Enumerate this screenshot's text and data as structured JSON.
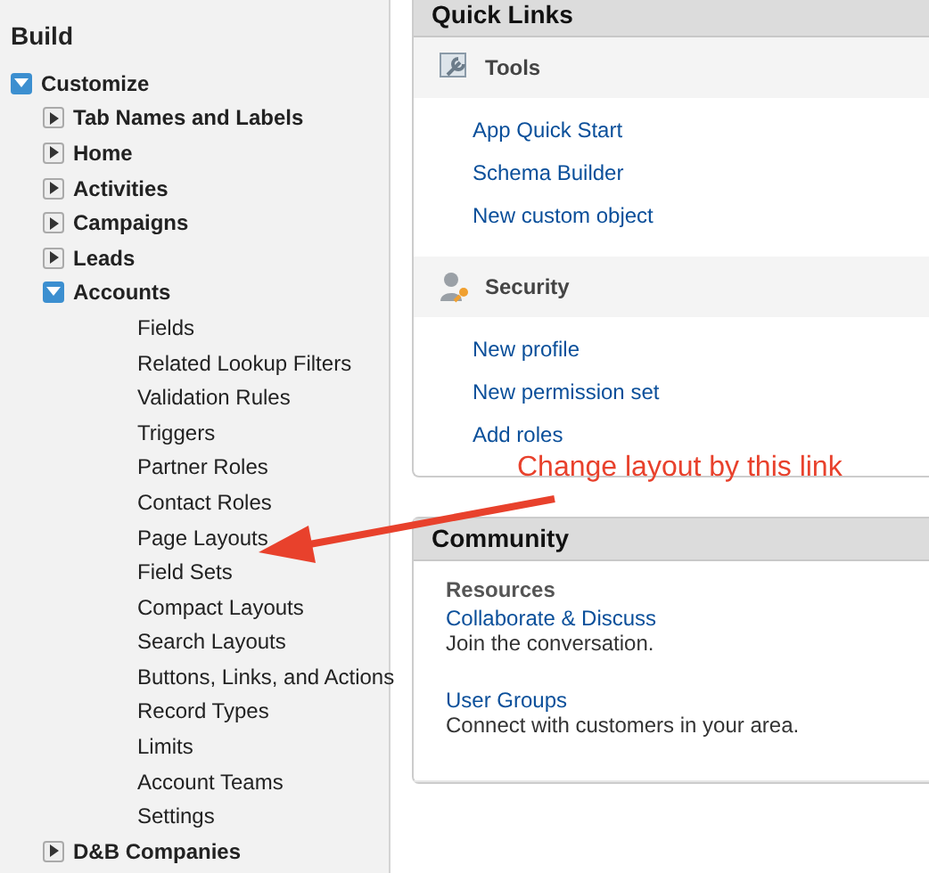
{
  "sidebar": {
    "title": "Build",
    "tree": [
      {
        "label": "Customize",
        "kind": "node",
        "expanded": true,
        "children": [
          {
            "label": "Tab Names and Labels",
            "kind": "node",
            "expanded": false
          },
          {
            "label": "Home",
            "kind": "node",
            "expanded": false
          },
          {
            "label": "Activities",
            "kind": "node",
            "expanded": false
          },
          {
            "label": "Campaigns",
            "kind": "node",
            "expanded": false
          },
          {
            "label": "Leads",
            "kind": "node",
            "expanded": false
          },
          {
            "label": "Accounts",
            "kind": "node",
            "expanded": true,
            "children": [
              {
                "label": "Fields",
                "kind": "leaf"
              },
              {
                "label": "Related Lookup Filters",
                "kind": "leaf"
              },
              {
                "label": "Validation Rules",
                "kind": "leaf"
              },
              {
                "label": "Triggers",
                "kind": "leaf"
              },
              {
                "label": "Partner Roles",
                "kind": "leaf"
              },
              {
                "label": "Contact Roles",
                "kind": "leaf"
              },
              {
                "label": "Page Layouts",
                "kind": "leaf"
              },
              {
                "label": "Field Sets",
                "kind": "leaf"
              },
              {
                "label": "Compact Layouts",
                "kind": "leaf"
              },
              {
                "label": "Search Layouts",
                "kind": "leaf"
              },
              {
                "label": "Buttons, Links, and Actions",
                "kind": "leaf"
              },
              {
                "label": "Record Types",
                "kind": "leaf"
              },
              {
                "label": "Limits",
                "kind": "leaf"
              },
              {
                "label": "Account Teams",
                "kind": "leaf"
              },
              {
                "label": "Settings",
                "kind": "leaf"
              }
            ]
          },
          {
            "label": "D&B Companies",
            "kind": "node",
            "expanded": false
          }
        ]
      }
    ]
  },
  "quick_links": {
    "title": "Quick Links",
    "sections": [
      {
        "title": "Tools",
        "kind": "tools",
        "links": [
          "App Quick Start",
          "Schema Builder",
          "New custom object"
        ]
      },
      {
        "title": "Security",
        "kind": "security",
        "links": [
          "New profile",
          "New permission set",
          "Add roles"
        ]
      }
    ]
  },
  "community": {
    "title": "Community",
    "heading": "Resources",
    "items": [
      {
        "link": "Collaborate & Discuss",
        "description": "Join the conversation."
      },
      {
        "link": "User Groups",
        "description": "Connect with customers in your area."
      }
    ]
  },
  "annotation": {
    "text": "Change layout by this link"
  }
}
